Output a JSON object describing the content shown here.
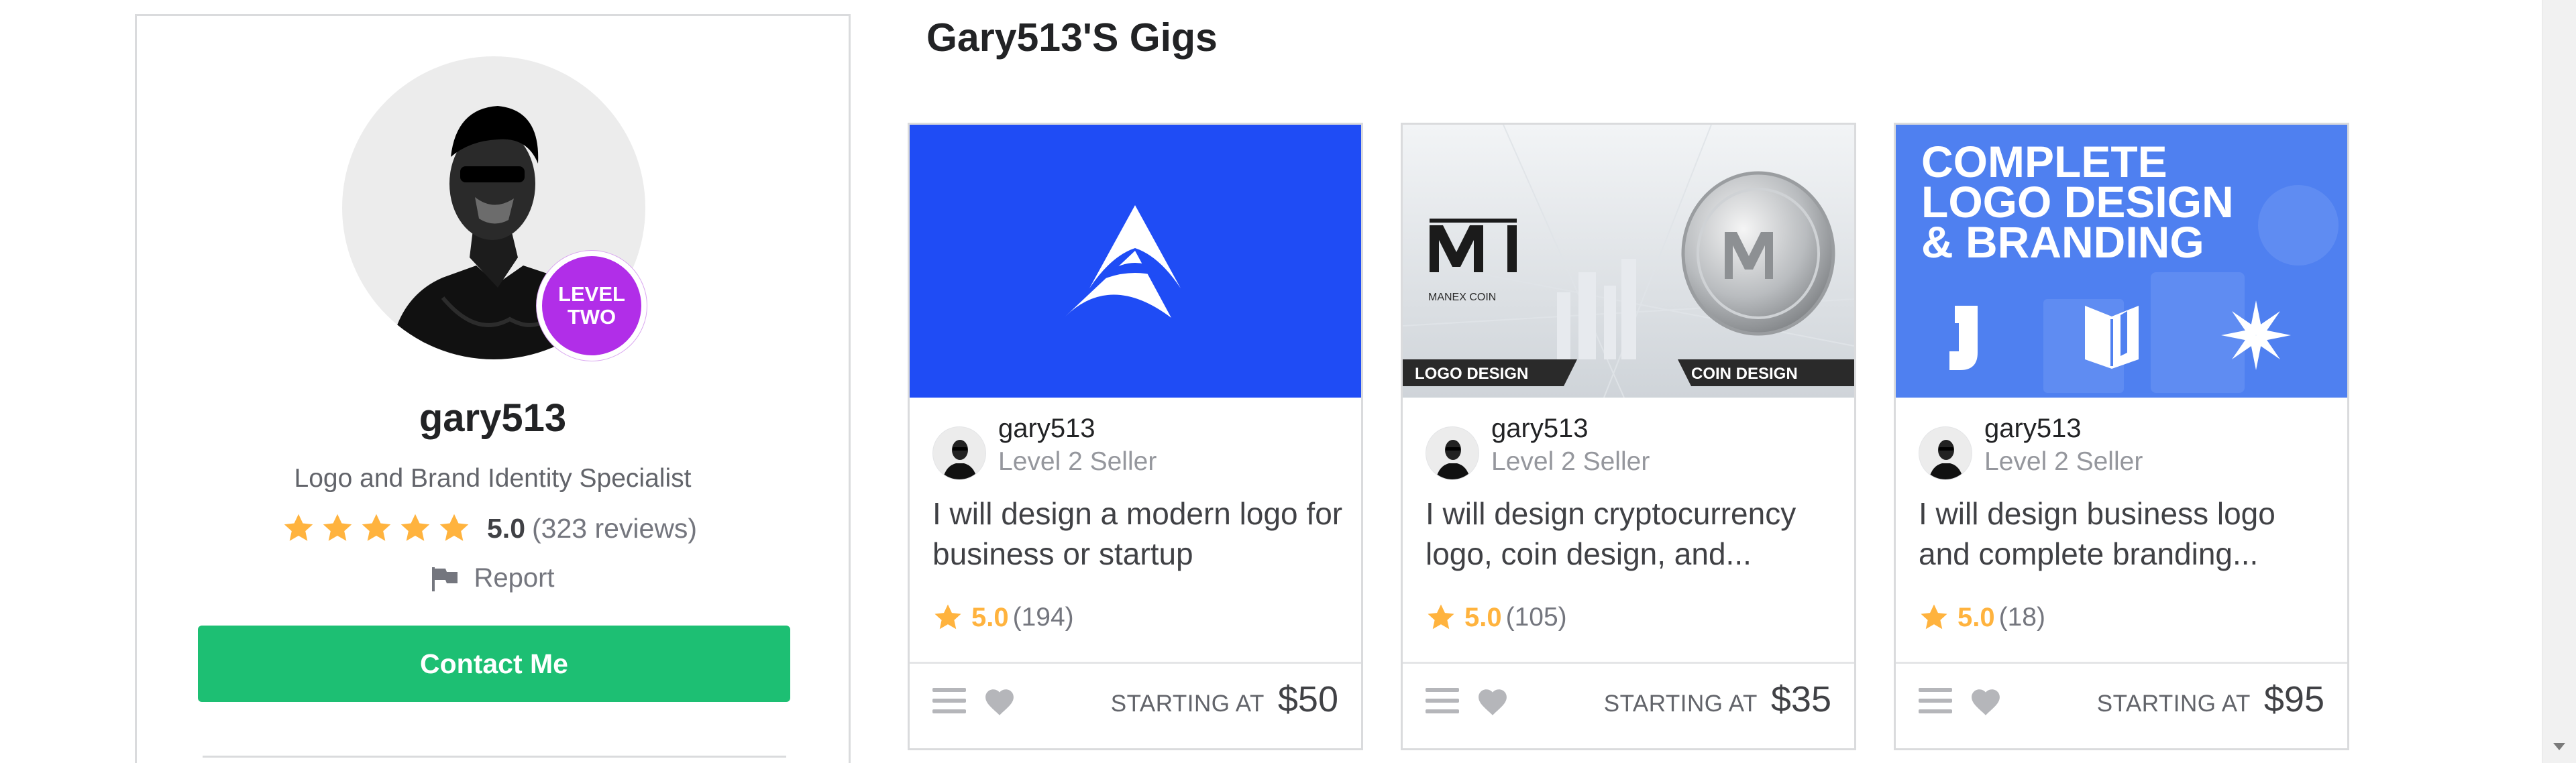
{
  "profile": {
    "username": "gary513",
    "level_badge": {
      "line1": "LEVEL",
      "line2": "TWO"
    },
    "tagline": "Logo and Brand Identity Specialist",
    "rating": {
      "stars": 5,
      "score": "5.0",
      "reviews": "(323 reviews)"
    },
    "report_label": "Report",
    "contact_label": "Contact Me"
  },
  "gigs_section": {
    "title": "Gary513'S Gigs"
  },
  "gigs": [
    {
      "seller": "gary513",
      "level": "Level 2 Seller",
      "title": "I will design a modern logo for business or startup",
      "score": "5.0",
      "count": "(194)",
      "starting_label": "STARTING AT",
      "price": "$50",
      "thumb": {
        "background": "#1f4cf5"
      }
    },
    {
      "seller": "gary513",
      "level": "Level 2 Seller",
      "title": "I will design cryptocurrency logo, coin design, and...",
      "score": "5.0",
      "count": "(105)",
      "starting_label": "STARTING AT",
      "price": "$35",
      "thumb": {
        "brand_text": "MANEX COIN",
        "left_label": "LOGO DESIGN",
        "right_label": "COIN DESIGN"
      }
    },
    {
      "seller": "gary513",
      "level": "Level 2 Seller",
      "title": "I will design business logo and complete branding...",
      "score": "5.0",
      "count": "(18)",
      "starting_label": "STARTING AT",
      "price": "$95",
      "thumb": {
        "headline_1": "COMPLETE",
        "headline_2": "LOGO DESIGN",
        "headline_3": "& BRANDING"
      }
    }
  ],
  "colors": {
    "accent_green": "#1dbf73",
    "star_yellow": "#ffb33e",
    "level_purple": "#b12ee8",
    "border": "#dadbdd"
  },
  "icons": [
    "star-icon",
    "flag-icon",
    "list-icon",
    "heart-icon",
    "chevron-down-icon"
  ]
}
